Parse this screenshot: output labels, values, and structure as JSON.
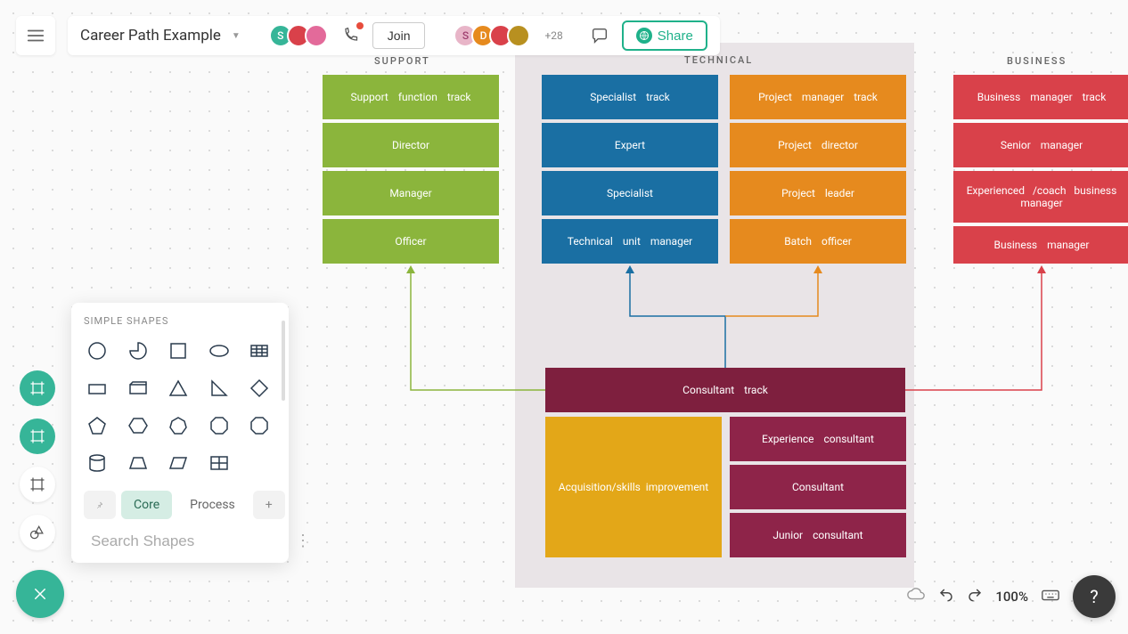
{
  "title": "Career Path Example",
  "toolbar": {
    "join": "Join",
    "share": "Share",
    "plus_count": "+28"
  },
  "panel": {
    "title": "SIMPLE SHAPES",
    "tab_core": "Core",
    "tab_process": "Process",
    "search_placeholder": "Search Shapes"
  },
  "zoom": "100%",
  "columns": {
    "support": "SUPPORT",
    "technical": "TECHNICAL",
    "business": "BUSINESS"
  },
  "tracks": {
    "support": [
      "Support function track",
      "Director",
      "Manager",
      "Officer"
    ],
    "specialist": [
      "Specialist track",
      "Expert",
      "Specialist",
      "Technical unit manager"
    ],
    "project": [
      "Project manager track",
      "Project director",
      "Project leader",
      "Batch officer"
    ],
    "business": [
      "Business manager track",
      "Senior manager",
      "Experienced /coach business manager",
      "Business manager"
    ],
    "consultant_header": "Consultant track",
    "acquisition": "Acquisition/skills improvement",
    "consultant_col": [
      "Experience consultant",
      "Consultant",
      "Junior consultant"
    ]
  },
  "colors": {
    "support": "#8bb53c",
    "specialist": "#1a6fa3",
    "project": "#e68a1e",
    "business": "#d9414a",
    "consultant": "#7e1f3e",
    "acquisition": "#e3a718"
  }
}
